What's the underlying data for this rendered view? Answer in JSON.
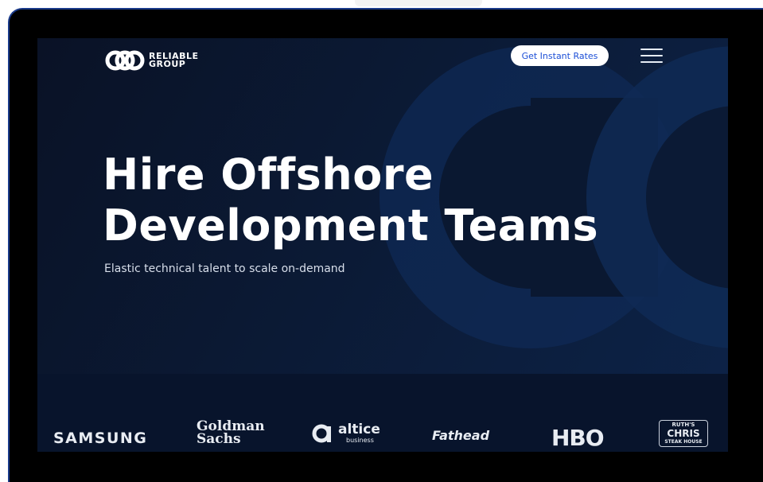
{
  "header": {
    "logo_line1": "RELIABLE",
    "logo_line2": "GROUP",
    "cta_label": "Get Instant Rates",
    "menu_icon": "hamburger-icon"
  },
  "hero": {
    "headline_line1": "Hire Offshore",
    "headline_line2": "Development Teams",
    "subheadline": "Elastic technical talent to scale on-demand"
  },
  "clients": {
    "samsung": "SAMSUNG",
    "goldman_line1": "Goldman",
    "goldman_line2": "Sachs",
    "altice_name": "altice",
    "altice_sub": "business",
    "fathead": "Fathead",
    "hbo": "HBO",
    "ruths_line1": "RUTH'S",
    "ruths_line2": "CHRIS",
    "ruths_line3": "STEAK HOUSE"
  },
  "colors": {
    "background": "#0b1a35",
    "cta_text": "#1c4fd7",
    "frame_border": "#1a3a8a"
  }
}
